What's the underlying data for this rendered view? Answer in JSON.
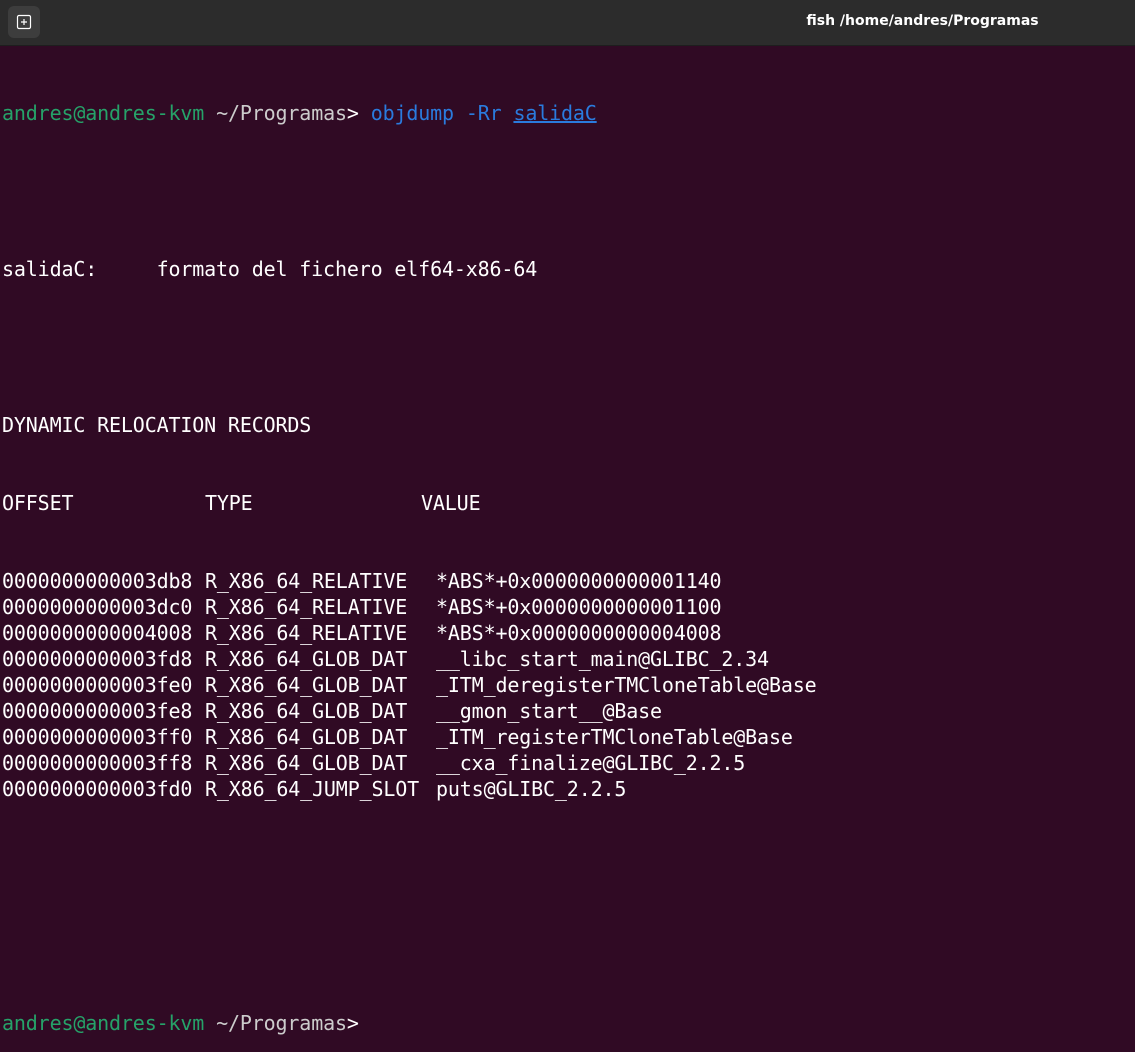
{
  "window": {
    "title": "fish /home/andres/Programas",
    "icons": {
      "new_tab": "new-tab-icon"
    }
  },
  "prompt": {
    "user_host": "andres@andres-kvm",
    "cwd": "~/Programas",
    "symbol": ">"
  },
  "command": {
    "name": "objdump",
    "flags": "-Rr",
    "target": "salidaC"
  },
  "output": {
    "file_line": "salidaC:     formato del fichero elf64-x86-64",
    "section_title": "DYNAMIC RELOCATION RECORDS",
    "headers": {
      "offset": "OFFSET",
      "type": "TYPE",
      "value": "VALUE"
    },
    "rows": [
      {
        "offset": "0000000000003db8",
        "type": "R_X86_64_RELATIVE",
        "value": "*ABS*+0x0000000000001140"
      },
      {
        "offset": "0000000000003dc0",
        "type": "R_X86_64_RELATIVE",
        "value": "*ABS*+0x0000000000001100"
      },
      {
        "offset": "0000000000004008",
        "type": "R_X86_64_RELATIVE",
        "value": "*ABS*+0x0000000000004008"
      },
      {
        "offset": "0000000000003fd8",
        "type": "R_X86_64_GLOB_DAT",
        "value": "__libc_start_main@GLIBC_2.34"
      },
      {
        "offset": "0000000000003fe0",
        "type": "R_X86_64_GLOB_DAT",
        "value": "_ITM_deregisterTMCloneTable@Base"
      },
      {
        "offset": "0000000000003fe8",
        "type": "R_X86_64_GLOB_DAT",
        "value": "__gmon_start__@Base"
      },
      {
        "offset": "0000000000003ff0",
        "type": "R_X86_64_GLOB_DAT",
        "value": "_ITM_registerTMCloneTable@Base"
      },
      {
        "offset": "0000000000003ff8",
        "type": "R_X86_64_GLOB_DAT",
        "value": "__cxa_finalize@GLIBC_2.2.5"
      },
      {
        "offset": "0000000000003fd0",
        "type": "R_X86_64_JUMP_SLOT",
        "value": "puts@GLIBC_2.2.5"
      }
    ]
  },
  "colors": {
    "background": "#300a24",
    "titlebar": "#2c2c2c",
    "prompt_user": "#26a269",
    "command": "#2a7bde",
    "text": "#ffffff"
  }
}
